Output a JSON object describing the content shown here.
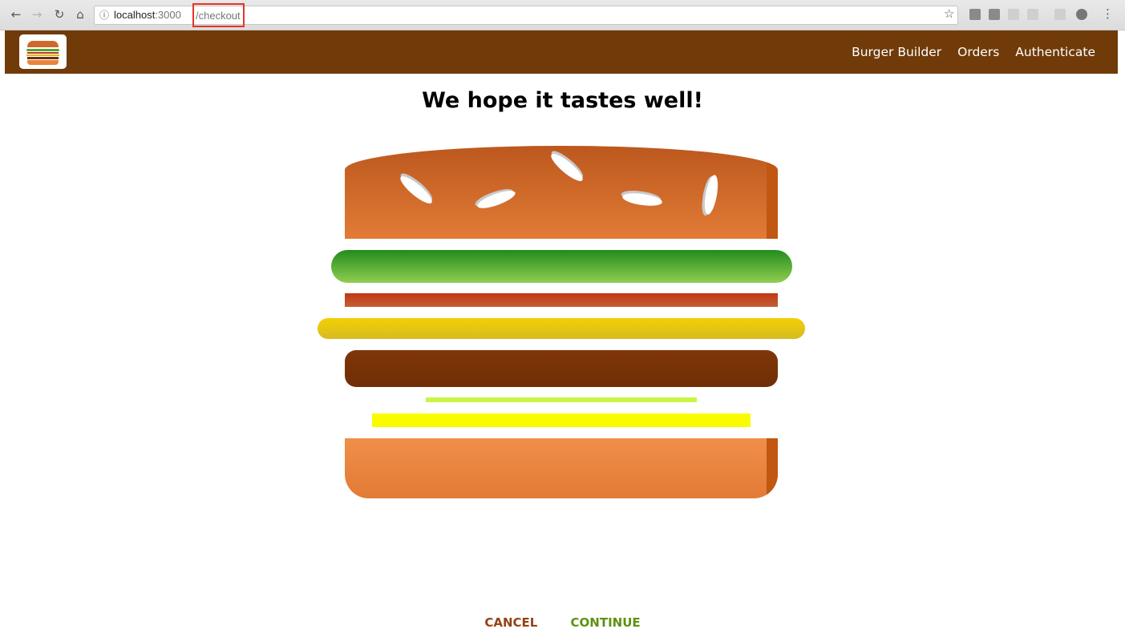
{
  "browser": {
    "url_host": "localhost",
    "url_port": ":3000",
    "url_path": "/checkout"
  },
  "toolbar": {
    "logo_icon": "burger-logo-icon",
    "nav": [
      {
        "label": "Burger Builder"
      },
      {
        "label": "Orders"
      },
      {
        "label": "Authenticate"
      }
    ]
  },
  "checkout": {
    "title": "We hope it tastes well!",
    "cancel_label": "CANCEL",
    "continue_label": "CONTINUE"
  },
  "burger": {
    "layers": [
      "bread-top",
      "salad",
      "bacon",
      "cheese",
      "meat",
      "onion",
      "yellow-strip",
      "bread-bottom"
    ]
  },
  "colors": {
    "toolbar_bg": "#703b09",
    "cancel": "#944317",
    "continue": "#5c9210"
  }
}
